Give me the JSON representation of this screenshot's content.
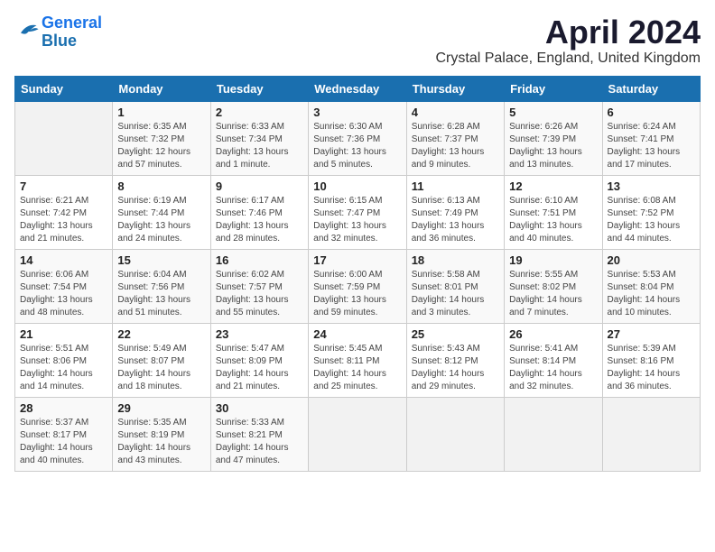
{
  "header": {
    "logo_line1": "General",
    "logo_line2": "Blue",
    "title": "April 2024",
    "subtitle": "Crystal Palace, England, United Kingdom"
  },
  "weekdays": [
    "Sunday",
    "Monday",
    "Tuesday",
    "Wednesday",
    "Thursday",
    "Friday",
    "Saturday"
  ],
  "weeks": [
    [
      {
        "day": "",
        "sunrise": "",
        "sunset": "",
        "daylight": ""
      },
      {
        "day": "1",
        "sunrise": "Sunrise: 6:35 AM",
        "sunset": "Sunset: 7:32 PM",
        "daylight": "Daylight: 12 hours and 57 minutes."
      },
      {
        "day": "2",
        "sunrise": "Sunrise: 6:33 AM",
        "sunset": "Sunset: 7:34 PM",
        "daylight": "Daylight: 13 hours and 1 minute."
      },
      {
        "day": "3",
        "sunrise": "Sunrise: 6:30 AM",
        "sunset": "Sunset: 7:36 PM",
        "daylight": "Daylight: 13 hours and 5 minutes."
      },
      {
        "day": "4",
        "sunrise": "Sunrise: 6:28 AM",
        "sunset": "Sunset: 7:37 PM",
        "daylight": "Daylight: 13 hours and 9 minutes."
      },
      {
        "day": "5",
        "sunrise": "Sunrise: 6:26 AM",
        "sunset": "Sunset: 7:39 PM",
        "daylight": "Daylight: 13 hours and 13 minutes."
      },
      {
        "day": "6",
        "sunrise": "Sunrise: 6:24 AM",
        "sunset": "Sunset: 7:41 PM",
        "daylight": "Daylight: 13 hours and 17 minutes."
      }
    ],
    [
      {
        "day": "7",
        "sunrise": "Sunrise: 6:21 AM",
        "sunset": "Sunset: 7:42 PM",
        "daylight": "Daylight: 13 hours and 21 minutes."
      },
      {
        "day": "8",
        "sunrise": "Sunrise: 6:19 AM",
        "sunset": "Sunset: 7:44 PM",
        "daylight": "Daylight: 13 hours and 24 minutes."
      },
      {
        "day": "9",
        "sunrise": "Sunrise: 6:17 AM",
        "sunset": "Sunset: 7:46 PM",
        "daylight": "Daylight: 13 hours and 28 minutes."
      },
      {
        "day": "10",
        "sunrise": "Sunrise: 6:15 AM",
        "sunset": "Sunset: 7:47 PM",
        "daylight": "Daylight: 13 hours and 32 minutes."
      },
      {
        "day": "11",
        "sunrise": "Sunrise: 6:13 AM",
        "sunset": "Sunset: 7:49 PM",
        "daylight": "Daylight: 13 hours and 36 minutes."
      },
      {
        "day": "12",
        "sunrise": "Sunrise: 6:10 AM",
        "sunset": "Sunset: 7:51 PM",
        "daylight": "Daylight: 13 hours and 40 minutes."
      },
      {
        "day": "13",
        "sunrise": "Sunrise: 6:08 AM",
        "sunset": "Sunset: 7:52 PM",
        "daylight": "Daylight: 13 hours and 44 minutes."
      }
    ],
    [
      {
        "day": "14",
        "sunrise": "Sunrise: 6:06 AM",
        "sunset": "Sunset: 7:54 PM",
        "daylight": "Daylight: 13 hours and 48 minutes."
      },
      {
        "day": "15",
        "sunrise": "Sunrise: 6:04 AM",
        "sunset": "Sunset: 7:56 PM",
        "daylight": "Daylight: 13 hours and 51 minutes."
      },
      {
        "day": "16",
        "sunrise": "Sunrise: 6:02 AM",
        "sunset": "Sunset: 7:57 PM",
        "daylight": "Daylight: 13 hours and 55 minutes."
      },
      {
        "day": "17",
        "sunrise": "Sunrise: 6:00 AM",
        "sunset": "Sunset: 7:59 PM",
        "daylight": "Daylight: 13 hours and 59 minutes."
      },
      {
        "day": "18",
        "sunrise": "Sunrise: 5:58 AM",
        "sunset": "Sunset: 8:01 PM",
        "daylight": "Daylight: 14 hours and 3 minutes."
      },
      {
        "day": "19",
        "sunrise": "Sunrise: 5:55 AM",
        "sunset": "Sunset: 8:02 PM",
        "daylight": "Daylight: 14 hours and 7 minutes."
      },
      {
        "day": "20",
        "sunrise": "Sunrise: 5:53 AM",
        "sunset": "Sunset: 8:04 PM",
        "daylight": "Daylight: 14 hours and 10 minutes."
      }
    ],
    [
      {
        "day": "21",
        "sunrise": "Sunrise: 5:51 AM",
        "sunset": "Sunset: 8:06 PM",
        "daylight": "Daylight: 14 hours and 14 minutes."
      },
      {
        "day": "22",
        "sunrise": "Sunrise: 5:49 AM",
        "sunset": "Sunset: 8:07 PM",
        "daylight": "Daylight: 14 hours and 18 minutes."
      },
      {
        "day": "23",
        "sunrise": "Sunrise: 5:47 AM",
        "sunset": "Sunset: 8:09 PM",
        "daylight": "Daylight: 14 hours and 21 minutes."
      },
      {
        "day": "24",
        "sunrise": "Sunrise: 5:45 AM",
        "sunset": "Sunset: 8:11 PM",
        "daylight": "Daylight: 14 hours and 25 minutes."
      },
      {
        "day": "25",
        "sunrise": "Sunrise: 5:43 AM",
        "sunset": "Sunset: 8:12 PM",
        "daylight": "Daylight: 14 hours and 29 minutes."
      },
      {
        "day": "26",
        "sunrise": "Sunrise: 5:41 AM",
        "sunset": "Sunset: 8:14 PM",
        "daylight": "Daylight: 14 hours and 32 minutes."
      },
      {
        "day": "27",
        "sunrise": "Sunrise: 5:39 AM",
        "sunset": "Sunset: 8:16 PM",
        "daylight": "Daylight: 14 hours and 36 minutes."
      }
    ],
    [
      {
        "day": "28",
        "sunrise": "Sunrise: 5:37 AM",
        "sunset": "Sunset: 8:17 PM",
        "daylight": "Daylight: 14 hours and 40 minutes."
      },
      {
        "day": "29",
        "sunrise": "Sunrise: 5:35 AM",
        "sunset": "Sunset: 8:19 PM",
        "daylight": "Daylight: 14 hours and 43 minutes."
      },
      {
        "day": "30",
        "sunrise": "Sunrise: 5:33 AM",
        "sunset": "Sunset: 8:21 PM",
        "daylight": "Daylight: 14 hours and 47 minutes."
      },
      {
        "day": "",
        "sunrise": "",
        "sunset": "",
        "daylight": ""
      },
      {
        "day": "",
        "sunrise": "",
        "sunset": "",
        "daylight": ""
      },
      {
        "day": "",
        "sunrise": "",
        "sunset": "",
        "daylight": ""
      },
      {
        "day": "",
        "sunrise": "",
        "sunset": "",
        "daylight": ""
      }
    ]
  ]
}
